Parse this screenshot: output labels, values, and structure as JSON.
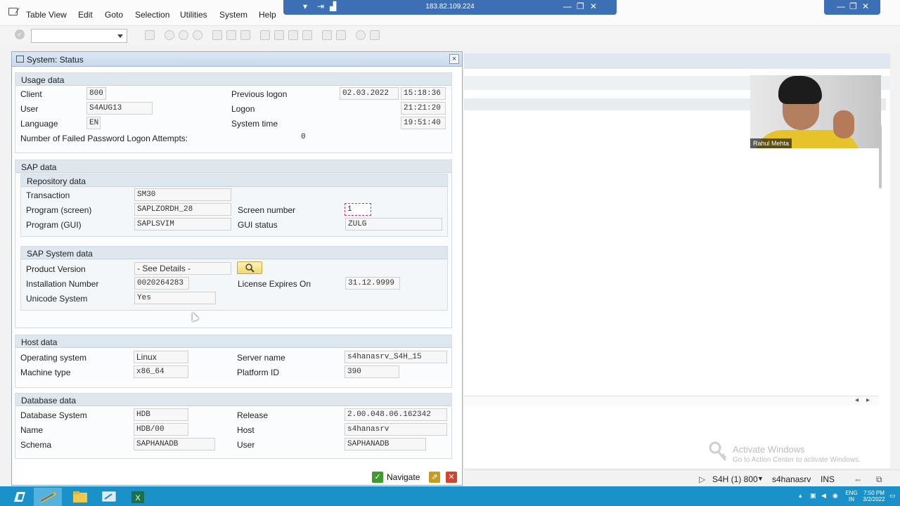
{
  "menubar": {
    "items": [
      "Table View",
      "Edit",
      "Goto",
      "Selection",
      "Utilities",
      "System",
      "Help"
    ]
  },
  "remote_bar": {
    "ip": "183.82.109.224"
  },
  "dialog": {
    "title": "System: Status",
    "close_glyph": "×",
    "usage": {
      "header": "Usage data",
      "client_label": "Client",
      "client": "800",
      "user_label": "User",
      "user": "S4AUG13",
      "language_label": "Language",
      "language": "EN",
      "failed_label": "Number of Failed Password Logon Attempts:",
      "failed": "0",
      "prev_logon_label": "Previous logon",
      "prev_logon_date": "02.03.2022",
      "prev_logon_time": "15:18:36",
      "logon_label": "Logon",
      "logon_time": "21:21:20",
      "systime_label": "System time",
      "systime": "19:51:40"
    },
    "sap": {
      "header": "SAP data",
      "repo_header": "Repository data",
      "transaction_label": "Transaction",
      "transaction": "SM30",
      "program_screen_label": "Program (screen)",
      "program_screen": "SAPLZORDH_28",
      "program_gui_label": "Program (GUI)",
      "program_gui": "SAPLSVIM",
      "screen_number_label": "Screen number",
      "screen_number": "1",
      "gui_status_label": "GUI status",
      "gui_status": "ZULG",
      "system_header": "SAP System data",
      "product_version_label": "Product Version",
      "product_version": "- See Details -",
      "installation_label": "Installation Number",
      "installation": "0020264283",
      "unicode_label": "Unicode System",
      "unicode": "Yes",
      "license_label": "License Expires On",
      "license": "31.12.9999"
    },
    "host": {
      "header": "Host data",
      "os_label": "Operating system",
      "os": "Linux",
      "machine_label": "Machine type",
      "machine": "x86_64",
      "server_label": "Server name",
      "server": "s4hanasrv_S4H_15",
      "platform_label": "Platform ID",
      "platform": "390"
    },
    "db": {
      "header": "Database data",
      "system_label": "Database System",
      "system": "HDB",
      "name_label": "Name",
      "name": "HDB/00",
      "schema_label": "Schema",
      "schema": "SAPHANADB",
      "release_label": "Release",
      "release": "2.00.048.06.162342",
      "host_label": "Host",
      "host": "s4hanasrv",
      "user_label": "User",
      "user": "SAPHANADB"
    },
    "navigate_label": "Navigate"
  },
  "statusbar": {
    "system": "S4H (1) 800",
    "server": "s4hanasrv",
    "mode": "INS"
  },
  "watermark": {
    "title": "Activate Windows",
    "subtitle": "Go to Action Center to activate Windows."
  },
  "webcam": {
    "name": "Rahul Mehta"
  },
  "tray": {
    "lang1": "ENG",
    "lang2": "IN",
    "time": "7:50 PM",
    "date": "3/2/2022"
  },
  "colors": {
    "taskbar": "#1a92c9",
    "remote_bar": "#3d6fb5",
    "excel": "#1e7145",
    "accept": "#3f9b2e",
    "cancel": "#d3452a"
  }
}
